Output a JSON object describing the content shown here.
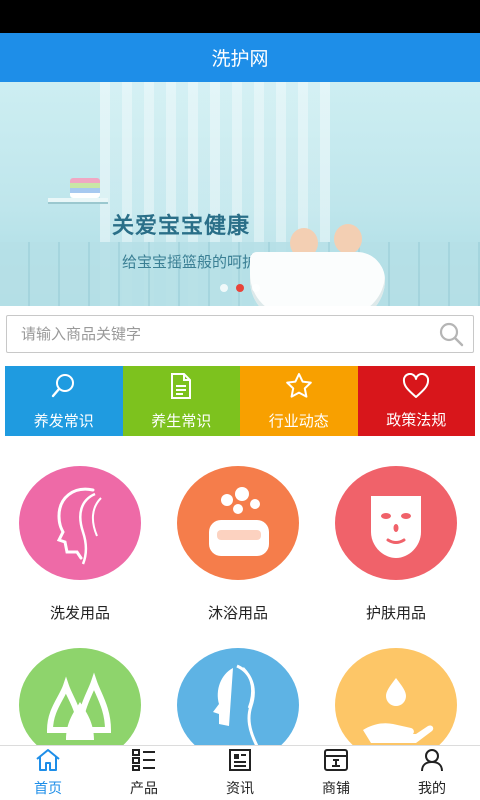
{
  "header": {
    "title": "洗护网"
  },
  "banner": {
    "headline": "关爱宝宝健康",
    "subline": "给宝宝摇篮般的呵护",
    "slide_count": 3,
    "active_slide": 2
  },
  "search": {
    "placeholder": "请输入商品关键字",
    "icon": "search-icon"
  },
  "categories": [
    {
      "label": "养发常识",
      "icon": "search-icon",
      "color": "#1f9be0"
    },
    {
      "label": "养生常识",
      "icon": "document-icon",
      "color": "#7dc21e"
    },
    {
      "label": "行业动态",
      "icon": "star-icon",
      "color": "#f8a000"
    },
    {
      "label": "政策法规",
      "icon": "heart-icon",
      "color": "#d8161b"
    }
  ],
  "products": [
    {
      "label": "洗发用品",
      "icon": "hair-profile-icon",
      "color": "#ee6aa7"
    },
    {
      "label": "沐浴用品",
      "icon": "soap-icon",
      "color": "#f57d4b"
    },
    {
      "label": "护肤用品",
      "icon": "face-mask-icon",
      "color": "#f0626a"
    },
    {
      "label": "",
      "icon": "leaf-drops-icon",
      "color": "#8ed46c"
    },
    {
      "label": "",
      "icon": "woman-profile-icon",
      "color": "#5eb3e4"
    },
    {
      "label": "",
      "icon": "hand-drop-icon",
      "color": "#fdc667"
    }
  ],
  "tabbar": [
    {
      "label": "首页",
      "icon": "home-icon",
      "active": true
    },
    {
      "label": "产品",
      "icon": "list-icon",
      "active": false
    },
    {
      "label": "资讯",
      "icon": "news-icon",
      "active": false
    },
    {
      "label": "商铺",
      "icon": "shop-icon",
      "active": false
    },
    {
      "label": "我的",
      "icon": "user-icon",
      "active": false
    }
  ],
  "colors": {
    "brand": "#1e8ee8",
    "active_dot": "#e8443a"
  }
}
